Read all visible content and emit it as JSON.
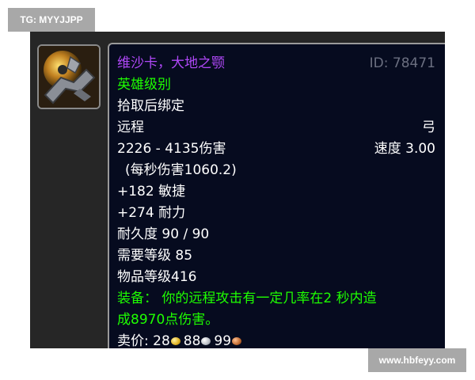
{
  "watermark_top": "TG: MYYJJPP",
  "watermark_bottom": "www.hbfeyy.com",
  "item": {
    "icon": "crossbow-weapon-icon",
    "name": "维沙卡，大地之颚",
    "id_label": "ID: 78471",
    "quality": "英雄级别",
    "binding": "拾取后绑定",
    "slot": "远程",
    "weapon_type": "弓",
    "damage": "2226 - 4135伤害",
    "speed": "速度 3.00",
    "dps": "(每秒伤害1060.2)",
    "stat_agility": "+182 敏捷",
    "stat_stamina": "+274 耐力",
    "durability": "耐久度 90 / 90",
    "required_level": "需要等级 85",
    "item_level": "物品等级416",
    "equip_line1": "装备：  你的远程攻击有一定几率在2 秒内造",
    "equip_line2": "成8970点伤害。",
    "sell_label": "卖价: ",
    "sell_gold": "28",
    "sell_silver": "88",
    "sell_copper": "99"
  },
  "colors": {
    "tooltip_bg": "#060b1f",
    "epic_purple": "#b048f8",
    "uncommon_green": "#1eff00",
    "id_gray": "#6b6f80"
  }
}
